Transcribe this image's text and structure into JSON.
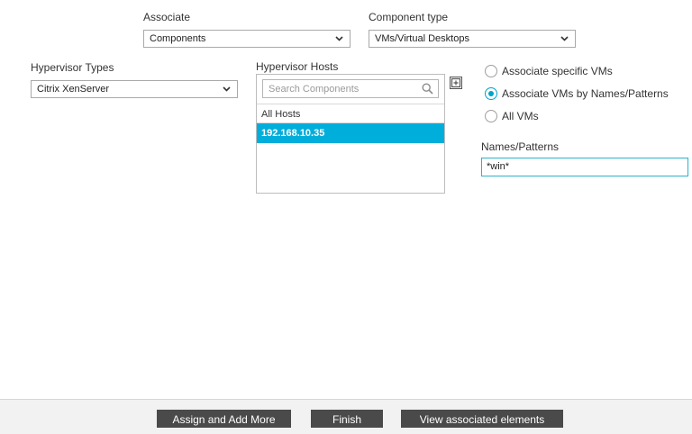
{
  "associate": {
    "label": "Associate",
    "selected": "Components",
    "icon": "chevron-down-icon"
  },
  "component_type": {
    "label": "Component type",
    "selected": "VMs/Virtual Desktops",
    "icon": "chevron-down-icon"
  },
  "hypervisor_types": {
    "label": "Hypervisor Types",
    "selected": "Citrix XenServer",
    "icon": "chevron-down-icon"
  },
  "hypervisor_hosts": {
    "label": "Hypervisor Hosts",
    "search_placeholder": "Search Components",
    "search_icon": "search-icon",
    "expand_icon": "expand-icon",
    "items": [
      {
        "label": "All Hosts",
        "selected": false
      },
      {
        "label": "192.168.10.35",
        "selected": true
      }
    ]
  },
  "association_mode": {
    "options": [
      {
        "label": "Associate specific VMs",
        "checked": false
      },
      {
        "label": "Associate VMs by Names/Patterns",
        "checked": true
      },
      {
        "label": "All VMs",
        "checked": false
      }
    ]
  },
  "names_patterns": {
    "label": "Names/Patterns",
    "value": "*win*"
  },
  "footer": {
    "assign_add_more": "Assign and Add More",
    "finish": "Finish",
    "view_associated": "View associated elements"
  },
  "colors": {
    "accent": "#00aedb",
    "button_bg": "#4a4a4a",
    "footer_bg": "#f2f2f2"
  }
}
